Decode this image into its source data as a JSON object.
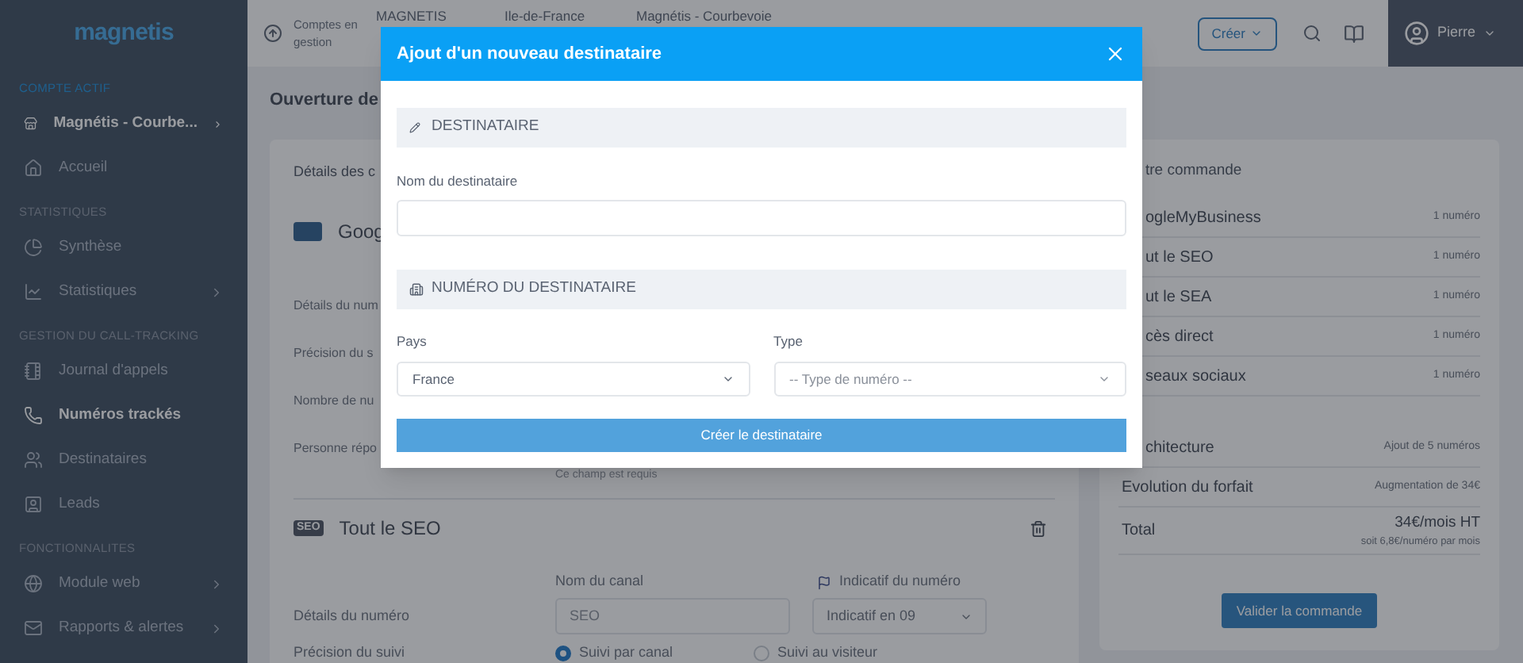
{
  "sidebar": {
    "logo": "magnetis",
    "items": [
      {
        "kind": "section",
        "label": "COMPTE ACTIF",
        "highlighted": true
      },
      {
        "kind": "account",
        "label": "Magnétis - Courbe...",
        "active": true,
        "submenu": true
      },
      {
        "kind": "link",
        "label": "Accueil",
        "active": false,
        "submenu": false
      },
      {
        "kind": "section",
        "label": "STATISTIQUES",
        "highlighted": false
      },
      {
        "kind": "link",
        "label": "Synthèse",
        "active": false,
        "submenu": false
      },
      {
        "kind": "link",
        "label": "Statistiques",
        "active": false,
        "submenu": true
      },
      {
        "kind": "section",
        "label": "GESTION DU CALL-TRACKING",
        "highlighted": false
      },
      {
        "kind": "link",
        "label": "Journal d'appels",
        "active": false,
        "submenu": false
      },
      {
        "kind": "link",
        "label": "Numéros trackés",
        "active": true,
        "submenu": false
      },
      {
        "kind": "link",
        "label": "Destinataires",
        "active": false,
        "submenu": false
      },
      {
        "kind": "link",
        "label": "Leads",
        "active": false,
        "submenu": false
      },
      {
        "kind": "section",
        "label": "FONCTIONNALITES",
        "highlighted": false
      },
      {
        "kind": "link",
        "label": "Module web",
        "active": false,
        "submenu": true
      },
      {
        "kind": "link",
        "label": "Rapports & alertes",
        "active": false,
        "submenu": true
      }
    ]
  },
  "topbar": {
    "accounts_label": "Comptes en gestion",
    "breadcrumbs": [
      "MAGNETIS",
      "Ile-de-France",
      "Magnétis - Courbevoie"
    ],
    "create_button": "Créer",
    "user": "Pierre"
  },
  "page_header": "Ouverture de",
  "details_card": {
    "title": "Détails des c",
    "google": {
      "name": "Goog",
      "row_labels": [
        "Détails du num",
        "Précision du s",
        "Nombre de nu",
        "Personne répo"
      ],
      "error": "Ce champ est requis"
    },
    "seo": {
      "badge": "SEO",
      "name": "Tout le SEO",
      "channel_label": "Nom du canal",
      "channel_value": "SEO",
      "prefix_label": "Indicatif du numéro",
      "prefix_value": "Indicatif en 09",
      "row_labels": [
        "Détails du numéro",
        "Précision du suivi"
      ],
      "tracking_options": [
        {
          "label": "Suivi par canal",
          "selected": true
        },
        {
          "label": "Suivi au visiteur",
          "selected": false
        }
      ]
    }
  },
  "order_card": {
    "title": "tre commande",
    "items": [
      {
        "name": "ogleMyBusiness",
        "count": "1 numéro"
      },
      {
        "name": "ut le SEO",
        "count": "1 numéro"
      },
      {
        "name": "ut le SEA",
        "count": "1 numéro"
      },
      {
        "name": "cès direct",
        "count": "1 numéro"
      },
      {
        "name": "seaux sociaux",
        "count": "1 numéro"
      }
    ],
    "summary": [
      {
        "label": "chitecture",
        "value": "Ajout de 5 numéros"
      },
      {
        "label": "Evolution du forfait",
        "value": "Augmentation de 34€"
      },
      {
        "label": "Total",
        "value": "34€/mois HT",
        "note": "soit 6,8€/numéro par mois"
      }
    ],
    "button": "Valider la commande"
  },
  "modal": {
    "title": "Ajout d'un nouveau destinataire",
    "recipient_section": "DESTINATAIRE",
    "name_label": "Nom du destinataire",
    "number_section": "NUMÉRO DU DESTINATAIRE",
    "country_label": "Pays",
    "country_value": "France",
    "type_label": "Type",
    "type_placeholder": "-- Type de numéro --",
    "submit": "Créer le destinataire"
  }
}
